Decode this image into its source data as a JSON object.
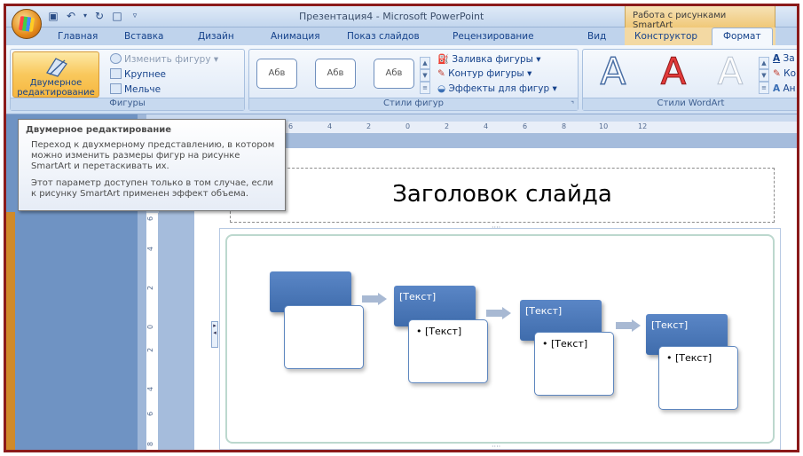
{
  "window": {
    "title": "Презентация4 - Microsoft PowerPoint",
    "context_title": "Работа с рисунками SmartArt"
  },
  "tabs": [
    {
      "label": "Главная"
    },
    {
      "label": "Вставка"
    },
    {
      "label": "Дизайн"
    },
    {
      "label": "Анимация"
    },
    {
      "label": "Показ слайдов"
    },
    {
      "label": "Рецензирование"
    },
    {
      "label": "Вид"
    },
    {
      "label": "Конструктор"
    },
    {
      "label": "Формат"
    }
  ],
  "ribbon": {
    "shapes_group": {
      "label": "Фигуры",
      "two_d_button": "Двумерное редактирование",
      "change_shape": "Изменить фигуру",
      "larger": "Крупнее",
      "smaller": "Мельче"
    },
    "shape_styles_group": {
      "label": "Стили фигур",
      "sample": "Абв",
      "fill": "Заливка фигуры",
      "outline": "Контур фигуры",
      "effects": "Эффекты для фигур"
    },
    "wordart_group": {
      "label": "Стили WordArt",
      "letter": "A",
      "fill_partial": "За",
      "outline_partial": "Ко",
      "effects_partial": "Ан"
    }
  },
  "tooltip": {
    "title": "Двумерное редактирование",
    "body1": "Переход к двухмерному представлению, в котором можно изменить размеры фигур на рисунке SmartArt и перетаскивать их.",
    "body2": "Этот параметр доступен только в том случае, если к рисунку SmartArt применен эффект объема."
  },
  "ruler": {
    "h_ticks": [
      "8",
      "6",
      "4",
      "2",
      "0",
      "2",
      "4",
      "6",
      "8",
      "10",
      "12"
    ],
    "v_ticks": [
      "6",
      "4",
      "2",
      "0",
      "2",
      "4",
      "6",
      "8"
    ]
  },
  "slide": {
    "title": "Заголовок слайда",
    "placeholder": "[Текст]",
    "bullet": "• [Текст]"
  },
  "colors": {
    "ribbon_bg": "#dbe7f6",
    "accent_orange": "#f9c85c",
    "smartart_blue": "#4f7bbd",
    "border_frame": "#8b1a1a"
  }
}
